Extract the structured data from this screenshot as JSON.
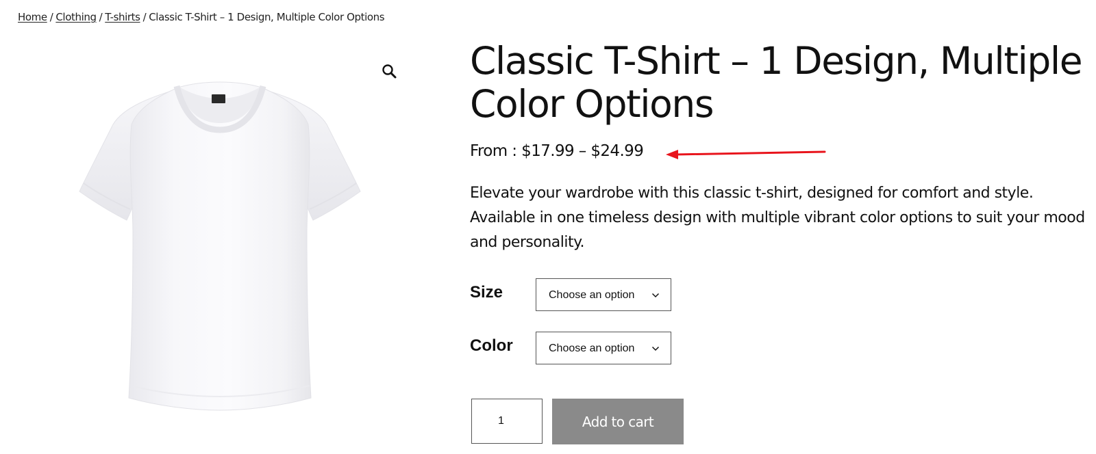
{
  "breadcrumb": {
    "items": [
      "Home",
      "Clothing",
      "T-shirts"
    ],
    "separator": "/",
    "current": "Classic T-Shirt – 1 Design, Multiple Color Options"
  },
  "gallery": {
    "zoom_icon": "magnifier-icon",
    "image": "white-tshirt"
  },
  "product": {
    "title": "Classic T-Shirt – 1 Design, Multiple Color Options",
    "price": "From : $17.99 – $24.99",
    "description": "Elevate your wardrobe with this classic t-shirt, designed for comfort and style. Available in one timeless design with multiple vibrant color options to suit your mood and personality."
  },
  "variations": [
    {
      "label": "Size",
      "selected": "Choose an option"
    },
    {
      "label": "Color",
      "selected": "Choose an option"
    }
  ],
  "cart": {
    "quantity": "1",
    "add_to_cart_label": "Add to cart"
  },
  "annotation": {
    "arrow_color": "#e8141c",
    "arrow_points_to": "price"
  },
  "colors": {
    "button_bg": "#8a8a8a",
    "text": "#111111"
  }
}
